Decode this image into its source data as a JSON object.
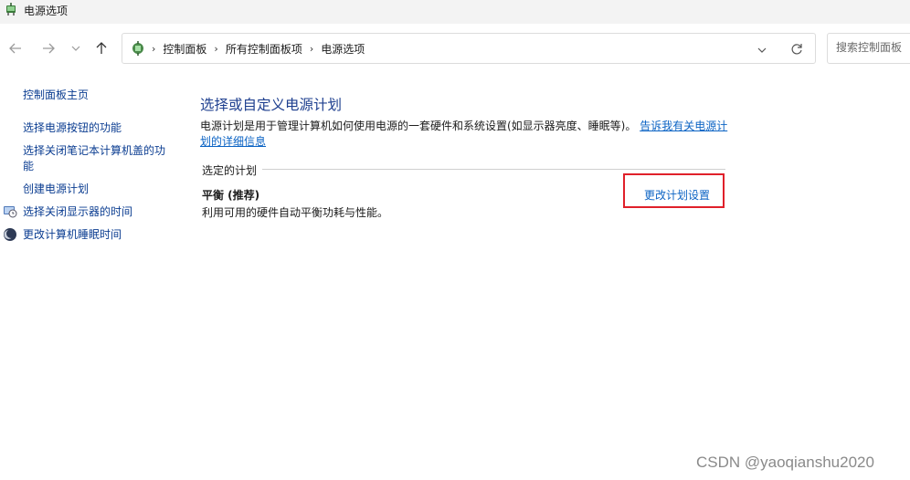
{
  "window": {
    "title": "电源选项",
    "app_icon": "power-options-icon"
  },
  "navigation": {
    "back_icon": "arrow-left-icon",
    "forward_icon": "arrow-right-icon",
    "recent_icon": "chevron-down-icon",
    "up_icon": "arrow-up-icon"
  },
  "address_bar": {
    "icon": "control-panel-icon",
    "breadcrumbs": [
      "控制面板",
      "所有控制面板项",
      "电源选项"
    ],
    "dropdown_icon": "chevron-down-icon",
    "refresh_icon": "refresh-icon"
  },
  "search": {
    "placeholder": "搜索控制面板"
  },
  "sidebar": {
    "items": [
      {
        "label": "控制面板主页",
        "icon": ""
      },
      {
        "label": "选择电源按钮的功能",
        "icon": ""
      },
      {
        "label": "选择关闭笔记本计算机盖的功能",
        "icon": ""
      },
      {
        "label": "创建电源计划",
        "icon": ""
      },
      {
        "label": "选择关闭显示器的时间",
        "icon": "monitor-clock-icon"
      },
      {
        "label": "更改计算机睡眠时间",
        "icon": "moon-icon"
      }
    ]
  },
  "main": {
    "title": "选择或自定义电源计划",
    "description": "电源计划是用于管理计算机如何使用电源的一套硬件和系统设置(如显示器亮度、睡眠等)。",
    "description_link": "告诉我有关电源计划的详细信息",
    "section_label": "选定的计划",
    "plan": {
      "name": "平衡 (推荐)",
      "description": "利用可用的硬件自动平衡功耗与性能。",
      "change_link": "更改计划设置"
    }
  },
  "watermark": "CSDN @yaoqianshu2020",
  "colors": {
    "link": "#0b63c4",
    "title": "#1e3f8f",
    "highlight": "#e0202a"
  }
}
